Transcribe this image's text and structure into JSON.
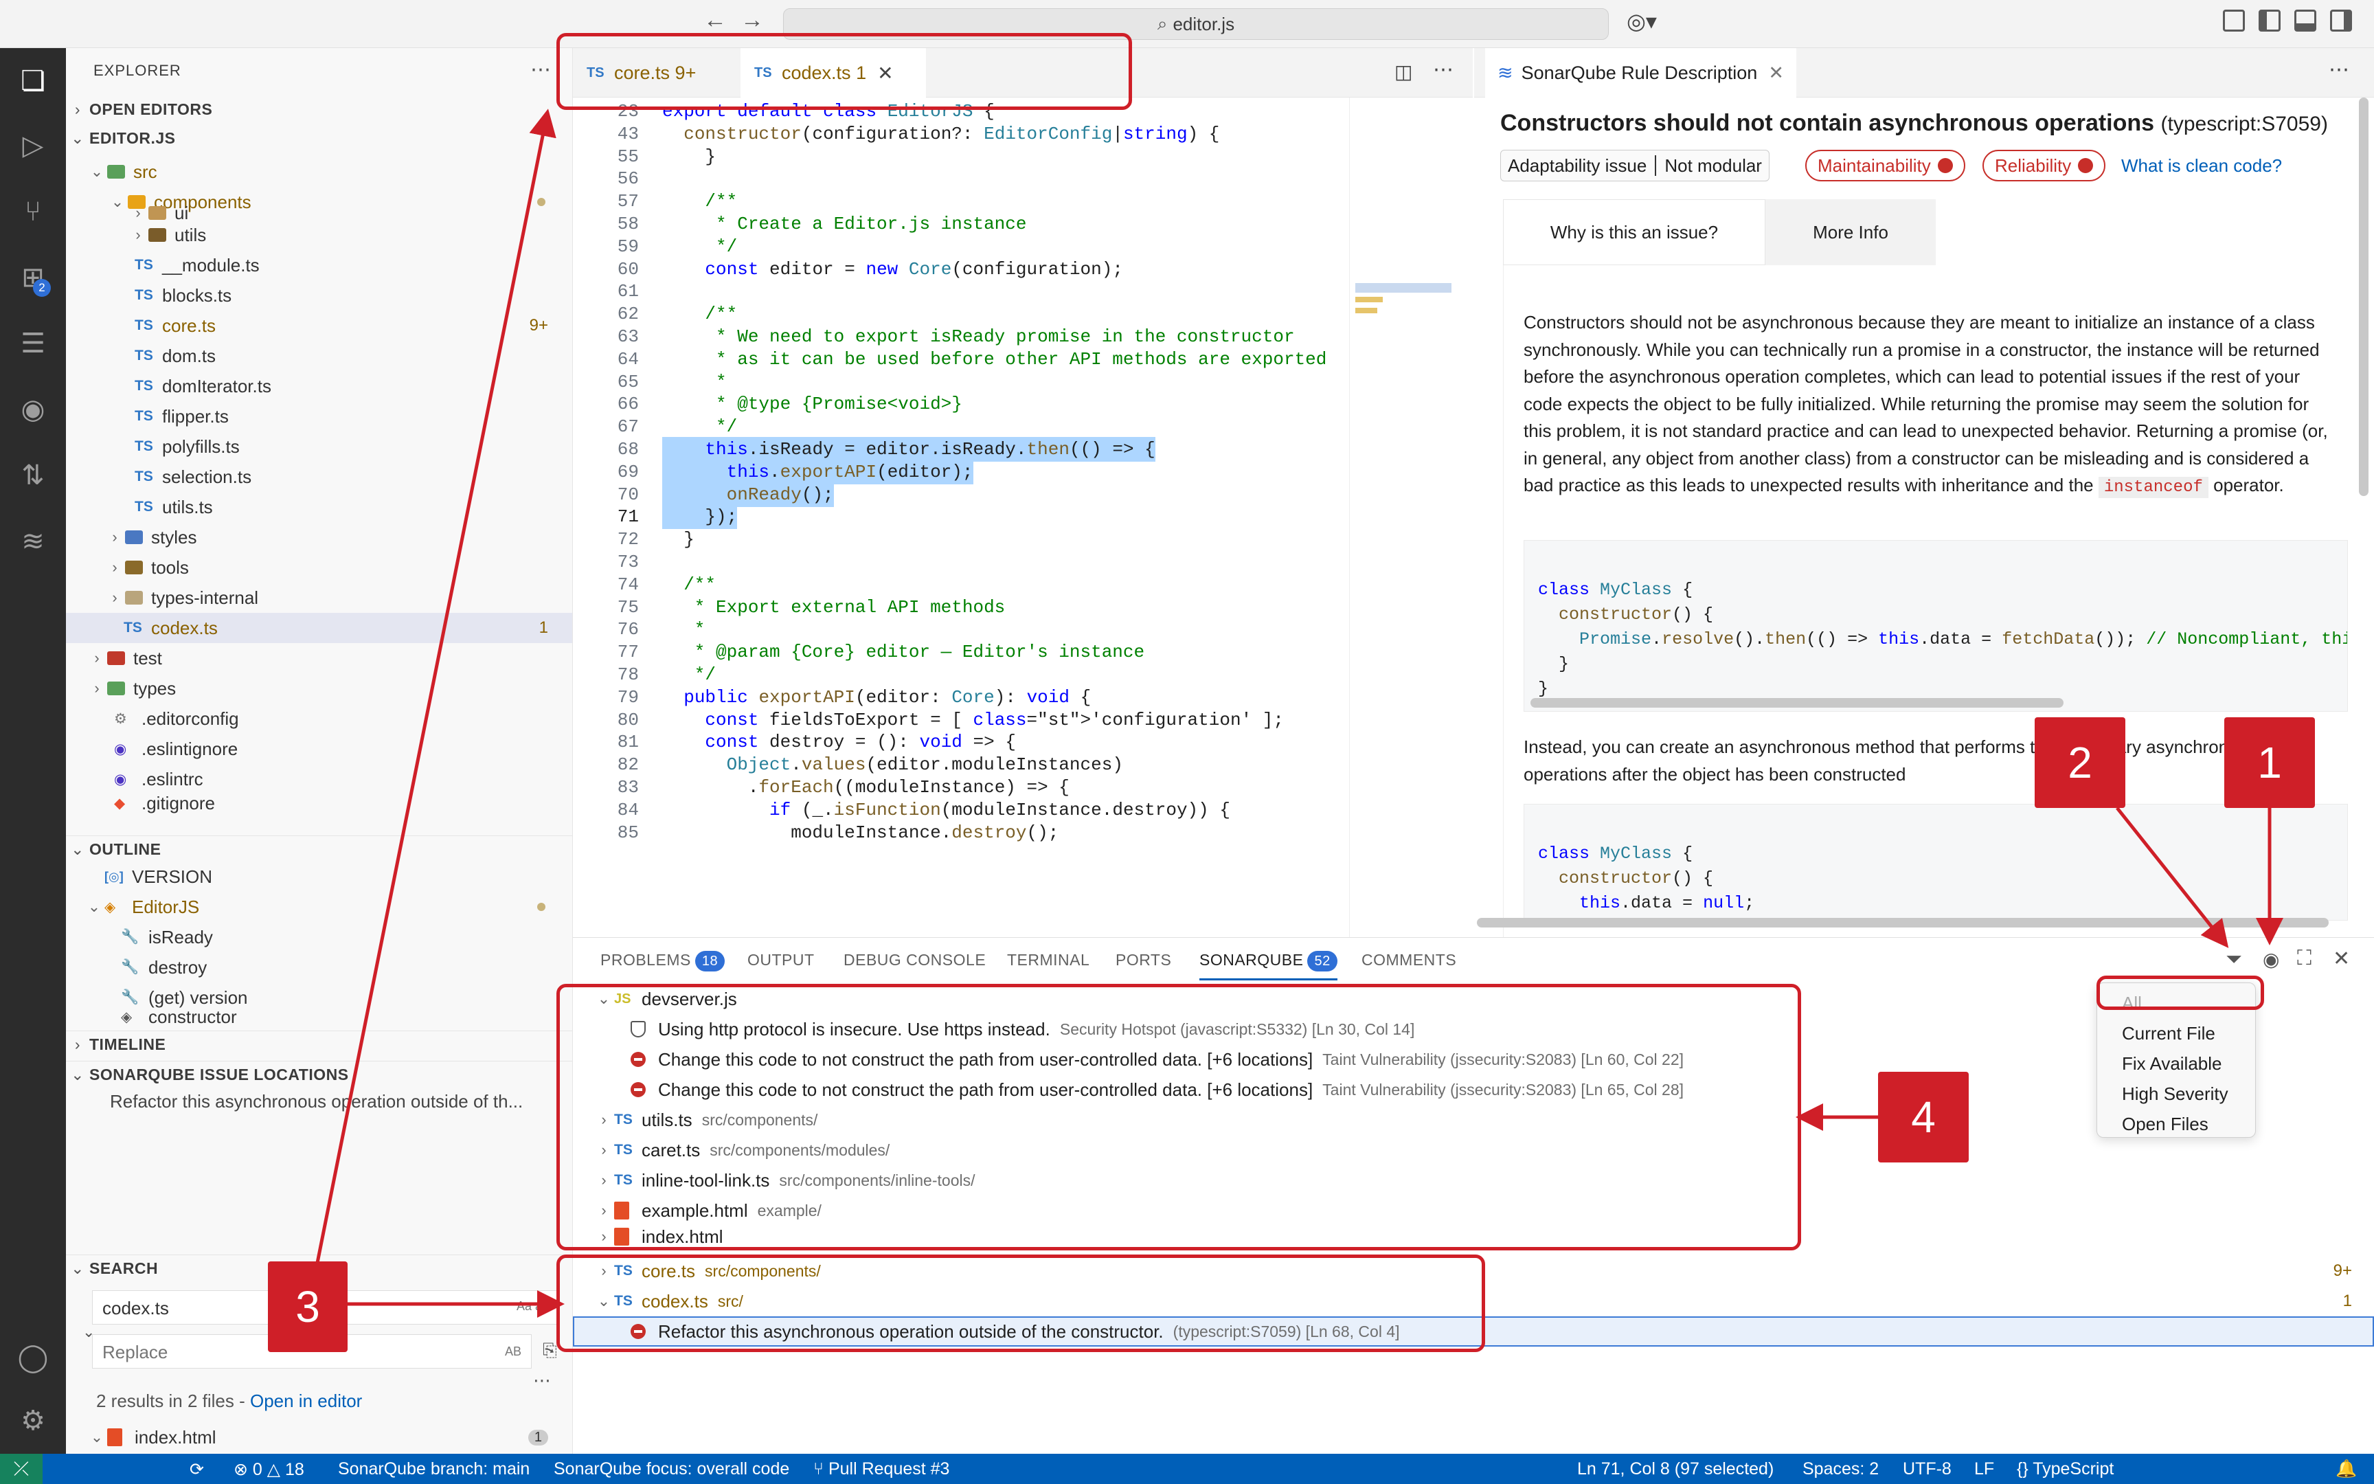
{
  "window": {
    "search": "editor.js"
  },
  "sidebar": {
    "title": "EXPLORER",
    "open_editors": "OPEN EDITORS",
    "root": "EDITOR.JS",
    "tree": [
      {
        "label": "src",
        "type": "folder"
      },
      {
        "label": "components",
        "type": "folder"
      },
      {
        "label": "ui",
        "type": "folder"
      },
      {
        "label": "utils",
        "type": "folder"
      },
      {
        "label": "__module.ts",
        "type": "ts"
      },
      {
        "label": "blocks.ts",
        "type": "ts"
      },
      {
        "label": "core.ts",
        "type": "ts",
        "badge": "9+"
      },
      {
        "label": "dom.ts",
        "type": "ts"
      },
      {
        "label": "domIterator.ts",
        "type": "ts"
      },
      {
        "label": "flipper.ts",
        "type": "ts"
      },
      {
        "label": "polyfills.ts",
        "type": "ts"
      },
      {
        "label": "selection.ts",
        "type": "ts"
      },
      {
        "label": "utils.ts",
        "type": "ts"
      },
      {
        "label": "styles",
        "type": "folder"
      },
      {
        "label": "tools",
        "type": "folder"
      },
      {
        "label": "types-internal",
        "type": "folder"
      },
      {
        "label": "codex.ts",
        "type": "ts",
        "badge": "1"
      },
      {
        "label": "test",
        "type": "folder"
      },
      {
        "label": "types",
        "type": "folder"
      },
      {
        "label": ".editorconfig",
        "type": "cfg"
      },
      {
        "label": ".eslintignore",
        "type": "cfg"
      },
      {
        "label": ".eslintrc",
        "type": "cfg"
      },
      {
        "label": ".gitignore",
        "type": "git"
      }
    ],
    "outline": "OUTLINE",
    "outline_items": [
      "VERSION",
      "EditorJS",
      "isReady",
      "destroy",
      "(get) version",
      "constructor"
    ],
    "timeline": "TIMELINE",
    "issue_locations": "SONARQUBE ISSUE LOCATIONS",
    "issue_location_text": "Refactor this asynchronous operation outside of th...",
    "search_title": "SEARCH",
    "search_value": "codex.ts",
    "replace_placeholder": "Replace",
    "results_text": "2 results in 2 files - ",
    "open_in_editor": "Open in editor",
    "bottom_file": "index.html",
    "bottom_badge": "1"
  },
  "editor": {
    "tabs": [
      {
        "label": "core.ts",
        "badge": "9+"
      },
      {
        "label": "codex.ts",
        "badge": "1"
      }
    ],
    "lines": [
      {
        "n": "23",
        "t": "export default class EditorJS {"
      },
      {
        "n": "43",
        "t": "  constructor(configuration?: EditorConfig|string) {"
      },
      {
        "n": "55",
        "t": "    }"
      },
      {
        "n": "56",
        "t": ""
      },
      {
        "n": "57",
        "t": "    /**"
      },
      {
        "n": "58",
        "t": "     * Create a Editor.js instance"
      },
      {
        "n": "59",
        "t": "     */"
      },
      {
        "n": "60",
        "t": "    const editor = new Core(configuration);"
      },
      {
        "n": "61",
        "t": ""
      },
      {
        "n": "62",
        "t": "    /**"
      },
      {
        "n": "63",
        "t": "     * We need to export isReady promise in the constructor"
      },
      {
        "n": "64",
        "t": "     * as it can be used before other API methods are exported"
      },
      {
        "n": "65",
        "t": "     *"
      },
      {
        "n": "66",
        "t": "     * @type {Promise<void>}"
      },
      {
        "n": "67",
        "t": "     */"
      },
      {
        "n": "68",
        "t": "    this.isReady = editor.isReady.then(() => {"
      },
      {
        "n": "69",
        "t": "      this.exportAPI(editor);"
      },
      {
        "n": "70",
        "t": "      onReady();"
      },
      {
        "n": "71",
        "t": "    });"
      },
      {
        "n": "72",
        "t": "  }"
      },
      {
        "n": "73",
        "t": ""
      },
      {
        "n": "74",
        "t": "  /**"
      },
      {
        "n": "75",
        "t": "   * Export external API methods"
      },
      {
        "n": "76",
        "t": "   *"
      },
      {
        "n": "77",
        "t": "   * @param {Core} editor — Editor's instance"
      },
      {
        "n": "78",
        "t": "   */"
      },
      {
        "n": "79",
        "t": "  public exportAPI(editor: Core): void {"
      },
      {
        "n": "80",
        "t": "    const fieldsToExport = [ 'configuration' ];"
      },
      {
        "n": "81",
        "t": "    const destroy = (): void => {"
      },
      {
        "n": "82",
        "t": "      Object.values(editor.moduleInstances)"
      },
      {
        "n": "83",
        "t": "        .forEach((moduleInstance) => {"
      },
      {
        "n": "84",
        "t": "          if (_.isFunction(moduleInstance.destroy)) {"
      },
      {
        "n": "85",
        "t": "            moduleInstance.destroy();"
      }
    ]
  },
  "rule": {
    "tab": "SonarQube Rule Description",
    "title": "Constructors should not contain asynchronous operations",
    "key": "(typescript:S7059)",
    "attr1": "Adaptability issue",
    "attr2": "Not modular",
    "tags": [
      "Maintainability",
      "Reliability"
    ],
    "clean_code_link": "What is clean code?",
    "tab1": "Why is this an issue?",
    "tab2": "More Info",
    "paragraph": "Constructors should not be asynchronous because they are meant to initialize an instance of a class synchronously. While you can technically run a promise in a constructor, the instance will be returned before the asynchronous operation completes, which can lead to potential issues if the rest of your code expects the object to be fully initialized. While returning the promise may seem the solution for this problem, it is not standard practice and can lead to unexpected behavior. Returning a promise (or, in general, any object from another class) from a constructor can be misleading and is considered a bad practice as this leads to unexpected results with inheritance and the",
    "instanceof": "instanceof",
    "operator": "operator.",
    "code1": [
      "class MyClass {",
      "  constructor() {",
      "    Promise.resolve().then(() => this.data = fetchData()); // Noncompliant, this.d",
      "  }",
      "}"
    ],
    "paragraph2": "Instead, you can create an asynchronous method that performs the necessary asynchronous operations after the object has been constructed",
    "code2": [
      "class MyClass {",
      "  constructor() {",
      "    this.data = null;",
      "  }"
    ]
  },
  "panel": {
    "tabs": [
      {
        "label": "PROBLEMS",
        "badge": "18"
      },
      {
        "label": "OUTPUT"
      },
      {
        "label": "DEBUG CONSOLE"
      },
      {
        "label": "TERMINAL"
      },
      {
        "label": "PORTS"
      },
      {
        "label": "SONARQUBE",
        "badge": "52"
      },
      {
        "label": "COMMENTS"
      }
    ],
    "rows": [
      {
        "kind": "file",
        "icon": "js",
        "label": "devserver.js",
        "path": ""
      },
      {
        "kind": "issue",
        "icon": "shield",
        "label": "Using http protocol is insecure. Use https instead.",
        "detail": "Security Hotspot (javascript:S5332) [Ln 30, Col 14]"
      },
      {
        "kind": "issue",
        "icon": "error",
        "label": "Change this code to not construct the path from user-controlled data. [+6 locations]",
        "detail": "Taint Vulnerability (jssecurity:S2083) [Ln 60, Col 22]"
      },
      {
        "kind": "issue",
        "icon": "error",
        "label": "Change this code to not construct the path from user-controlled data. [+6 locations]",
        "detail": "Taint Vulnerability (jssecurity:S2083) [Ln 65, Col 28]"
      },
      {
        "kind": "file",
        "icon": "ts",
        "label": "utils.ts",
        "path": "src/components/"
      },
      {
        "kind": "file",
        "icon": "ts",
        "label": "caret.ts",
        "path": "src/components/modules/"
      },
      {
        "kind": "file",
        "icon": "ts",
        "label": "inline-tool-link.ts",
        "path": "src/components/inline-tools/"
      },
      {
        "kind": "file",
        "icon": "html",
        "label": "example.html",
        "path": "example/"
      },
      {
        "kind": "file",
        "icon": "html",
        "label": "index.html",
        "path": ""
      },
      {
        "kind": "file",
        "icon": "ts",
        "label": "core.ts",
        "path": "src/components/",
        "count": "9+"
      },
      {
        "kind": "file",
        "icon": "ts",
        "label": "codex.ts",
        "path": "src/",
        "count": "1"
      },
      {
        "kind": "issue",
        "icon": "error",
        "label": "Refactor this asynchronous operation outside of the constructor.",
        "detail": "(typescript:S7059) [Ln 68, Col 4]"
      }
    ],
    "filter_menu": [
      "All",
      "Current File",
      "Fix Available",
      "High Severity",
      "Open Files"
    ]
  },
  "statusbar": {
    "problems": "0",
    "warnings": "18",
    "branch": "SonarQube branch: main",
    "focus": "SonarQube focus: overall code",
    "pr": "Pull Request #3",
    "position": "Ln 71, Col 8 (97 selected)",
    "spaces": "Spaces: 2",
    "encoding": "UTF-8",
    "eol": "LF",
    "language": "TypeScript"
  },
  "annotations": {
    "callouts": [
      "1",
      "2",
      "3",
      "4"
    ],
    "color": "#cf1f28"
  }
}
